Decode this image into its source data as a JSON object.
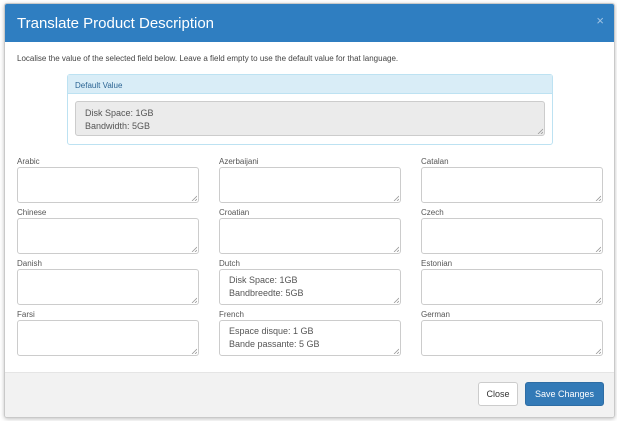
{
  "modal": {
    "title": "Translate Product Description",
    "close_glyph": "×",
    "instructions": "Localise the value of the selected field below. Leave a field empty to use the default value for that language."
  },
  "default_value": {
    "heading": "Default Value",
    "lines": [
      "Disk Space: 1GB",
      "Bandwidth: 5GB"
    ]
  },
  "languages": [
    {
      "label": "Arabic",
      "lines": []
    },
    {
      "label": "Azerbaijani",
      "lines": []
    },
    {
      "label": "Catalan",
      "lines": []
    },
    {
      "label": "Chinese",
      "lines": []
    },
    {
      "label": "Croatian",
      "lines": []
    },
    {
      "label": "Czech",
      "lines": []
    },
    {
      "label": "Danish",
      "lines": []
    },
    {
      "label": "Dutch",
      "lines": [
        "Disk Space: 1GB",
        "Bandbreedte: 5GB"
      ]
    },
    {
      "label": "Estonian",
      "lines": []
    },
    {
      "label": "Farsi",
      "lines": []
    },
    {
      "label": "French",
      "lines": [
        "Espace disque: 1 GB",
        "Bande passante: 5 GB"
      ]
    },
    {
      "label": "German",
      "lines": []
    }
  ],
  "footer": {
    "close_label": "Close",
    "save_label": "Save Changes"
  }
}
